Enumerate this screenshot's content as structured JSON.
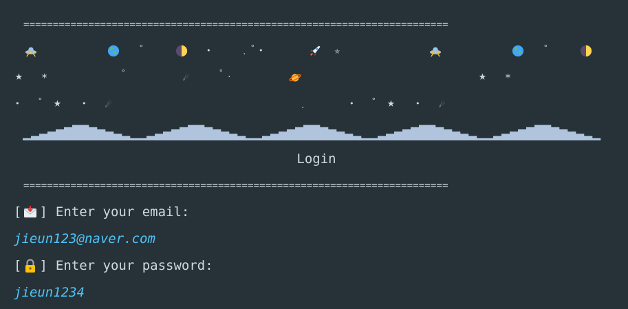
{
  "banner": {
    "rule": "========================================================================",
    "title": "Login"
  },
  "prompts": {
    "email_label": "Enter your email:",
    "email_icon": "envelope-icon",
    "password_label": "Enter your password:",
    "password_icon": "lock-icon",
    "open_bracket": "[",
    "close_bracket": "]"
  },
  "answers": {
    "email": "jieun123@naver.com",
    "password": "jieun1234"
  },
  "decorations": {
    "row1": [
      "ufo-icon",
      "earth-icon",
      "moon-icon",
      "rocket-icon",
      "star-icon",
      "ufo-icon",
      "earth-icon",
      "moon-icon"
    ],
    "row2": [
      "star-icon",
      "star-icon",
      "comet-icon",
      "planet-icon",
      "star-icon",
      "star-icon"
    ],
    "row3": [
      "star-icon",
      "comet-icon",
      "star-icon",
      "comet-icon"
    ]
  },
  "colors": {
    "background": "#263238",
    "text": "#cfd8dc",
    "input_text": "#4fc3f7",
    "skyline": "#b0c4de"
  }
}
